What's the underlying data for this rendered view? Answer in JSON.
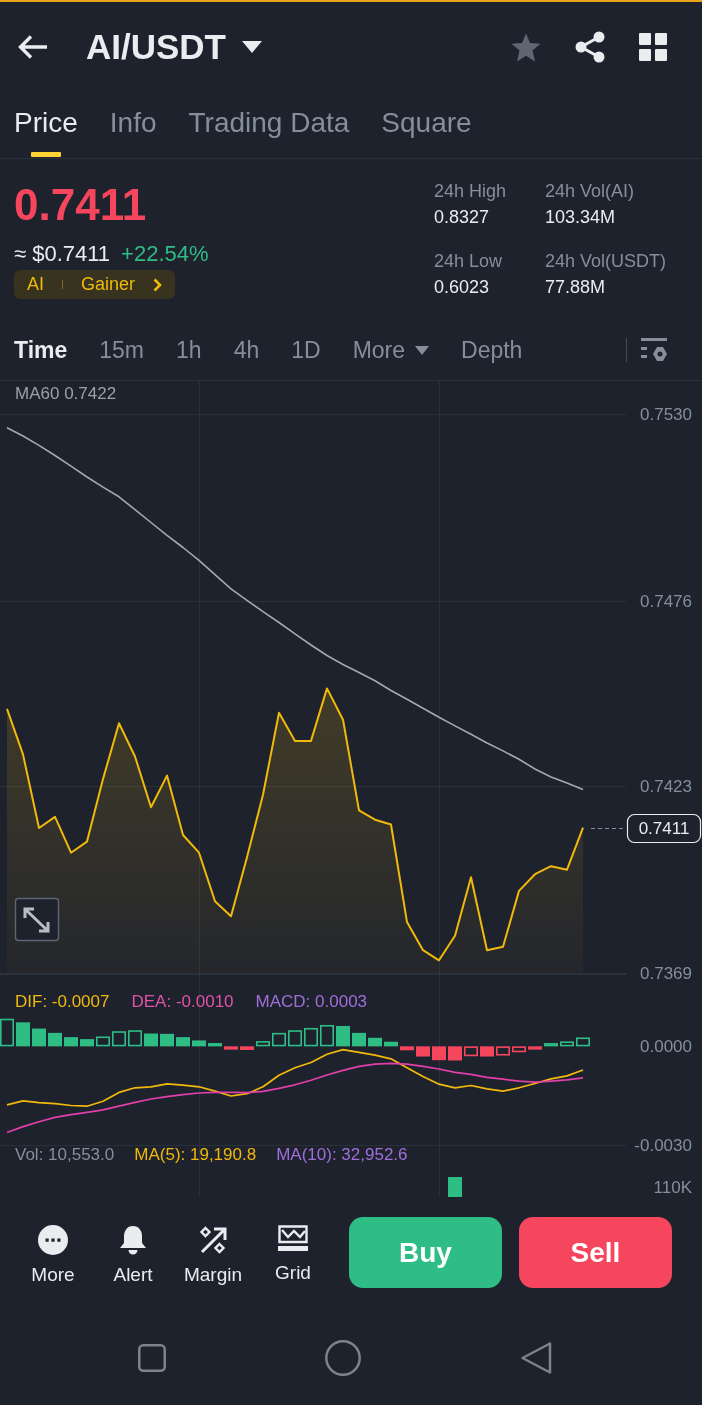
{
  "header": {
    "title": "AI/USDT",
    "favorite": false
  },
  "tabs": [
    {
      "label": "Price",
      "selected": true
    },
    {
      "label": "Info",
      "selected": false
    },
    {
      "label": "Trading Data",
      "selected": false
    },
    {
      "label": "Square",
      "selected": false
    }
  ],
  "ticker": {
    "last_price": "0.7411",
    "fiat_price": "≈ $0.7411",
    "change": "+22.54%",
    "tags": [
      "AI",
      "Gainer"
    ],
    "stats": [
      {
        "label": "24h High",
        "value": "0.8327"
      },
      {
        "label": "24h Vol(AI)",
        "value": "103.34M"
      },
      {
        "label": "24h Low",
        "value": "0.6023"
      },
      {
        "label": "24h Vol(USDT)",
        "value": "77.88M"
      }
    ]
  },
  "intervals": [
    {
      "label": "Time",
      "selected": true,
      "kind": "option"
    },
    {
      "label": "15m",
      "selected": false,
      "kind": "option"
    },
    {
      "label": "1h",
      "selected": false,
      "kind": "option"
    },
    {
      "label": "4h",
      "selected": false,
      "kind": "option"
    },
    {
      "label": "1D",
      "selected": false,
      "kind": "option"
    },
    {
      "label": "More",
      "selected": false,
      "kind": "dropdown"
    },
    {
      "label": "Depth",
      "selected": false,
      "kind": "option"
    }
  ],
  "price_chart": {
    "legend": [
      {
        "text": "MA60 0.7422",
        "color": "#9aa0a8"
      }
    ],
    "last_price_tag": "0.7411",
    "chart_data": {
      "type": "line",
      "grid": true,
      "series": [
        {
          "type": "area",
          "color": "#f0b90b",
          "values": [
            0.74452,
            0.74321,
            0.74109,
            0.74141,
            0.74038,
            0.7407,
            0.7425,
            0.74411,
            0.74315,
            0.74169,
            0.7426,
            0.74089,
            0.74038,
            0.73898,
            0.73855,
            0.74025,
            0.74205,
            0.74441,
            0.7436,
            0.7436,
            0.74511,
            0.74421,
            0.7416,
            0.74133,
            0.74119,
            0.73838,
            0.73757,
            0.73728,
            0.73799,
            0.73967,
            0.73757,
            0.73767,
            0.73928,
            0.73976,
            0.73999,
            0.73989,
            0.7411
          ]
        },
        {
          "type": "line",
          "color": "#a3a8b1",
          "values": [
            0.75262,
            0.75238,
            0.75211,
            0.75182,
            0.75151,
            0.7512,
            0.75091,
            0.75063,
            0.75026,
            0.74989,
            0.74952,
            0.74917,
            0.7488,
            0.74839,
            0.74798,
            0.74765,
            0.74732,
            0.74701,
            0.74668,
            0.74636,
            0.74606,
            0.7458,
            0.74557,
            0.74533,
            0.74505,
            0.7448,
            0.74454,
            0.74428,
            0.74403,
            0.74379,
            0.74354,
            0.74331,
            0.74307,
            0.74279,
            0.74256,
            0.74239,
            0.7422
          ]
        }
      ],
      "ylim": [
        0.7369,
        0.753
      ],
      "yticks": [
        {
          "value": 0.753,
          "label": "0.7530"
        },
        {
          "value": 0.7476,
          "label": "0.7476"
        },
        {
          "value": 0.7423,
          "label": "0.7423"
        },
        {
          "value": 0.7369,
          "label": "0.7369"
        }
      ]
    }
  },
  "macd_chart": {
    "legend": [
      {
        "text": "DIF: -0.0007",
        "color": "#f0b90b"
      },
      {
        "text": "DEA: -0.0010",
        "color": "#e052a8"
      },
      {
        "text": "MACD: 0.0003",
        "color": "#a06ed8"
      }
    ],
    "chart_data": {
      "type": "line",
      "grid": true,
      "series": [
        {
          "type": "line",
          "color": "#f0b90b",
          "values": [
            -0.00178,
            -0.00166,
            -0.00171,
            -0.00174,
            -0.0018,
            -0.00182,
            -0.00167,
            -0.0014,
            -0.00126,
            -0.00123,
            -0.00114,
            -0.00118,
            -0.00123,
            -0.00136,
            -0.00151,
            -0.00144,
            -0.00123,
            -0.00088,
            -0.00065,
            -0.00049,
            -0.00024,
            -0.0001,
            -0.00018,
            -0.00027,
            -0.00038,
            -0.00065,
            -0.00092,
            -0.00115,
            -0.00126,
            -0.00119,
            -0.00129,
            -0.00136,
            -0.00126,
            -0.00113,
            -0.00099,
            -0.0009,
            -0.00072
          ]
        },
        {
          "type": "line",
          "color": "#e040a8",
          "values": [
            -0.00262,
            -0.00244,
            -0.00229,
            -0.00216,
            -0.00208,
            -0.00201,
            -0.00193,
            -0.00182,
            -0.0017,
            -0.0016,
            -0.00153,
            -0.00147,
            -0.00142,
            -0.0014,
            -0.0014,
            -0.00141,
            -0.00137,
            -0.00128,
            -0.00117,
            -0.00103,
            -0.00087,
            -0.00073,
            -0.00061,
            -0.00054,
            -0.00052,
            -0.00054,
            -0.00061,
            -0.00069,
            -0.00079,
            -0.00085,
            -0.00094,
            -0.001,
            -0.00106,
            -0.00109,
            -0.00106,
            -0.00102,
            -0.00096
          ]
        },
        {
          "type": "bar",
          "values": [
            0.00084,
            0.00073,
            0.00054,
            0.00041,
            0.00028,
            0.00022,
            0.0003,
            0.00046,
            0.00049,
            0.00039,
            0.00038,
            0.00028,
            0.00018,
            0.0001,
            -0.0001,
            -0.00011,
            0.00016,
            0.00041,
            0.00049,
            0.00056,
            0.00065,
            0.00062,
            0.00041,
            0.00026,
            0.00014,
            -0.00012,
            -0.00031,
            -0.00042,
            -0.00043,
            -0.0003,
            -0.00031,
            -0.00028,
            -0.00018,
            -0.0001,
            0.0001,
            0.00015,
            0.00027
          ],
          "colors": [
            "#2ebd85",
            "#2ebd85",
            "#2ebd85",
            "#2ebd85",
            "#2ebd85",
            "#2ebd85",
            "#2ebd85",
            "#2ebd85",
            "#2ebd85",
            "#2ebd85",
            "#2ebd85",
            "#2ebd85",
            "#2ebd85",
            "#2ebd85",
            "#f6465d",
            "#f6465d",
            "#2ebd85",
            "#2ebd85",
            "#2ebd85",
            "#2ebd85",
            "#2ebd85",
            "#2ebd85",
            "#2ebd85",
            "#2ebd85",
            "#2ebd85",
            "#f6465d",
            "#f6465d",
            "#f6465d",
            "#f6465d",
            "#f6465d",
            "#f6465d",
            "#f6465d",
            "#f6465d",
            "#f6465d",
            "#2ebd85",
            "#2ebd85",
            "#2ebd85"
          ]
        }
      ],
      "ylim": [
        -0.003,
        0.0022
      ],
      "yticks": [
        {
          "value": 0,
          "label": "0.0000"
        },
        {
          "value": -0.003,
          "label": "-0.0030"
        }
      ]
    }
  },
  "volume_pane": {
    "legend": [
      {
        "text": "Vol: 10,553.0",
        "color": "#848e9c"
      },
      {
        "text": "MA(5): 19,190.8",
        "color": "#f0b90b"
      },
      {
        "text": "MA(10): 32,952.6",
        "color": "#a06ed8"
      }
    ],
    "axis_label": "110K"
  },
  "actions": [
    {
      "label": "More"
    },
    {
      "label": "Alert"
    },
    {
      "label": "Margin"
    },
    {
      "label": "Grid"
    }
  ],
  "trade_buttons": [
    {
      "label": "Buy",
      "kind": "buy"
    },
    {
      "label": "Sell",
      "kind": "sell"
    }
  ]
}
